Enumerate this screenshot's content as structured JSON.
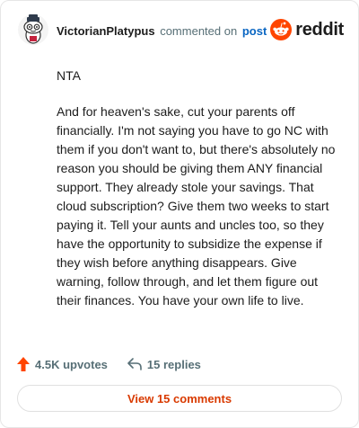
{
  "header": {
    "username": "VictorianPlatypus",
    "action_text": "commented on",
    "link_text": "post",
    "brand_name": "reddit",
    "brand_color": "#ff4500"
  },
  "comment": {
    "paragraphs": [
      "NTA",
      "And for heaven's sake, cut your parents off financially. I'm not saying you have to go NC with them if you don't want to, but there's absolutely no reason you should be giving them ANY financial support. They already stole your savings. That cloud subscription? Give them two weeks to start paying it. Tell your aunts and uncles too, so they have the opportunity to subsidize the expense if they wish before anything disappears. Give warning, follow through, and let them figure out their finances. You have your own life to live."
    ]
  },
  "actions": {
    "upvotes_label": "4.5K upvotes",
    "upvote_icon": "upvote-arrow-icon",
    "upvote_color": "#ff4500",
    "replies_label": "15 replies",
    "reply_icon": "reply-arrow-icon"
  },
  "footer": {
    "view_comments_label": "View 15 comments",
    "accent_color": "#d93a00"
  }
}
